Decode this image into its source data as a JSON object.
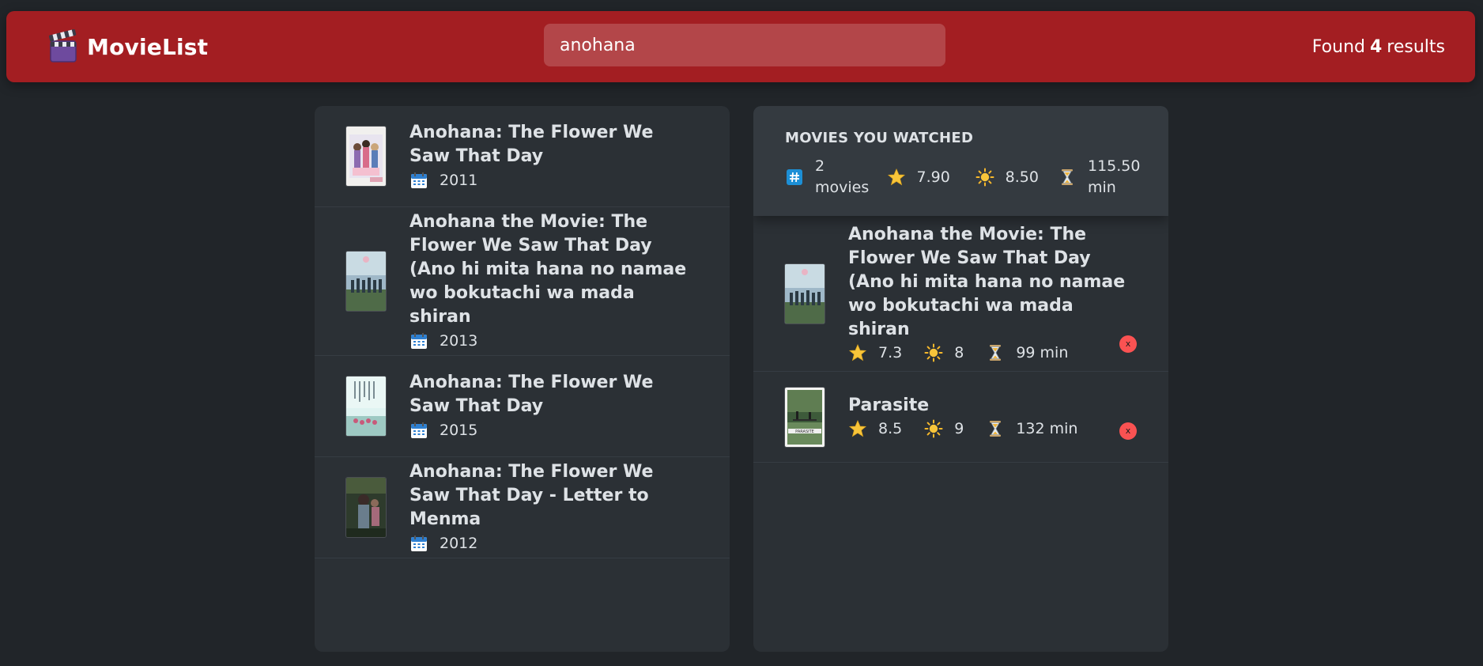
{
  "navbar": {
    "logo_text": "MovieList",
    "search_value": "anohana",
    "results_prefix": "Found",
    "results_count": "4",
    "results_suffix": "results",
    "accent_color": "#a31e22"
  },
  "search_results": [
    {
      "title": "Anohana: The Flower We Saw That Day",
      "year": "2011",
      "icon": "calendar-icon"
    },
    {
      "title": "Anohana the Movie: The Flower We Saw That Day (Ano hi mita hana no namae wo bokutachi wa mada shiran",
      "year": "2013",
      "icon": "calendar-icon"
    },
    {
      "title": "Anohana: The Flower We Saw That Day",
      "year": "2015",
      "icon": "calendar-icon"
    },
    {
      "title": "Anohana: The Flower We Saw That Day - Letter to Menma",
      "year": "2012",
      "icon": "calendar-icon"
    }
  ],
  "summary": {
    "heading": "MOVIES YOU WATCHED",
    "count_value": "2",
    "count_unit": "movies",
    "imdb_avg": "7.90",
    "user_avg": "8.50",
    "runtime_value": "115.50",
    "runtime_unit": "min"
  },
  "watched": [
    {
      "title": "Anohana the Movie: The Flower We Saw That Day (Ano hi mita hana no namae wo bokutachi wa mada shiran",
      "imdb": "7.3",
      "user": "8",
      "runtime": "99 min",
      "delete_label": "x"
    },
    {
      "title": "Parasite",
      "imdb": "8.5",
      "user": "9",
      "runtime": "132 min",
      "delete_label": "x"
    }
  ],
  "colors": {
    "background": "#212529",
    "box": "#2b3035",
    "summary_box": "#343a40",
    "delete": "#fa5252"
  }
}
